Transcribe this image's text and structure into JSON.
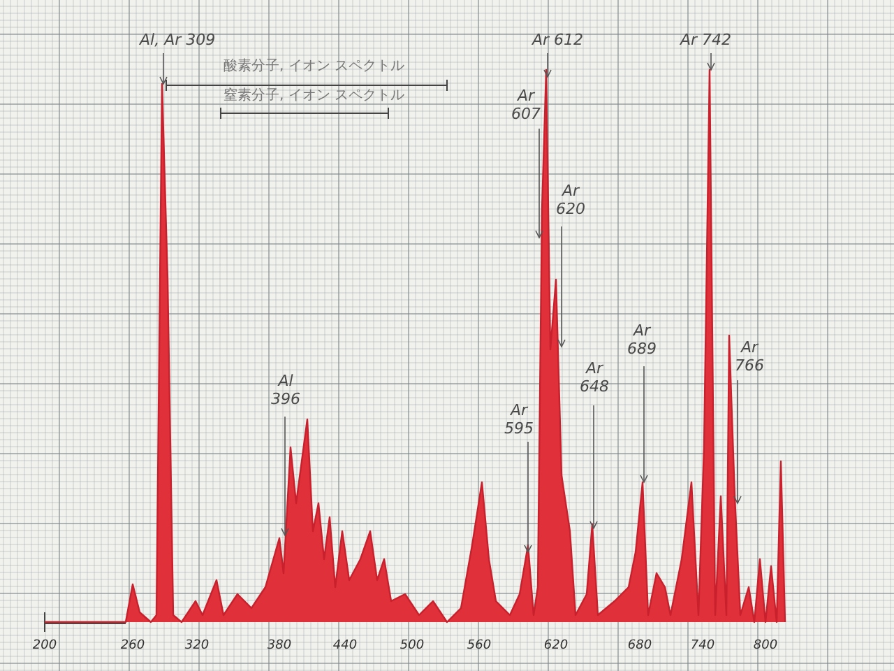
{
  "ranges": [
    {
      "label": "酸素分子, イオン スペクトル"
    },
    {
      "label": "窒素分子, イオン スペクトル"
    }
  ],
  "peaks": [
    {
      "kind": "inline",
      "element": "Al, Ar",
      "wavelength": "309"
    },
    {
      "kind": "inline",
      "element": "Ar",
      "wavelength": "612"
    },
    {
      "kind": "stacked",
      "element": "Ar",
      "wavelength": "607"
    },
    {
      "kind": "stacked",
      "element": "Ar",
      "wavelength": "620"
    },
    {
      "kind": "inline",
      "element": "Ar",
      "wavelength": "742"
    },
    {
      "kind": "stacked",
      "element": "Ar",
      "wavelength": "595"
    },
    {
      "kind": "stacked",
      "element": "Ar",
      "wavelength": "648"
    },
    {
      "kind": "stacked",
      "element": "Ar",
      "wavelength": "689"
    },
    {
      "kind": "stacked",
      "element": "Ar",
      "wavelength": "766"
    },
    {
      "kind": "stacked",
      "element": "Al",
      "wavelength": "396"
    }
  ],
  "x_axis_labels": [
    "200",
    "260",
    "320",
    "380",
    "440",
    "500",
    "560",
    "620",
    "680",
    "740",
    "800"
  ]
}
